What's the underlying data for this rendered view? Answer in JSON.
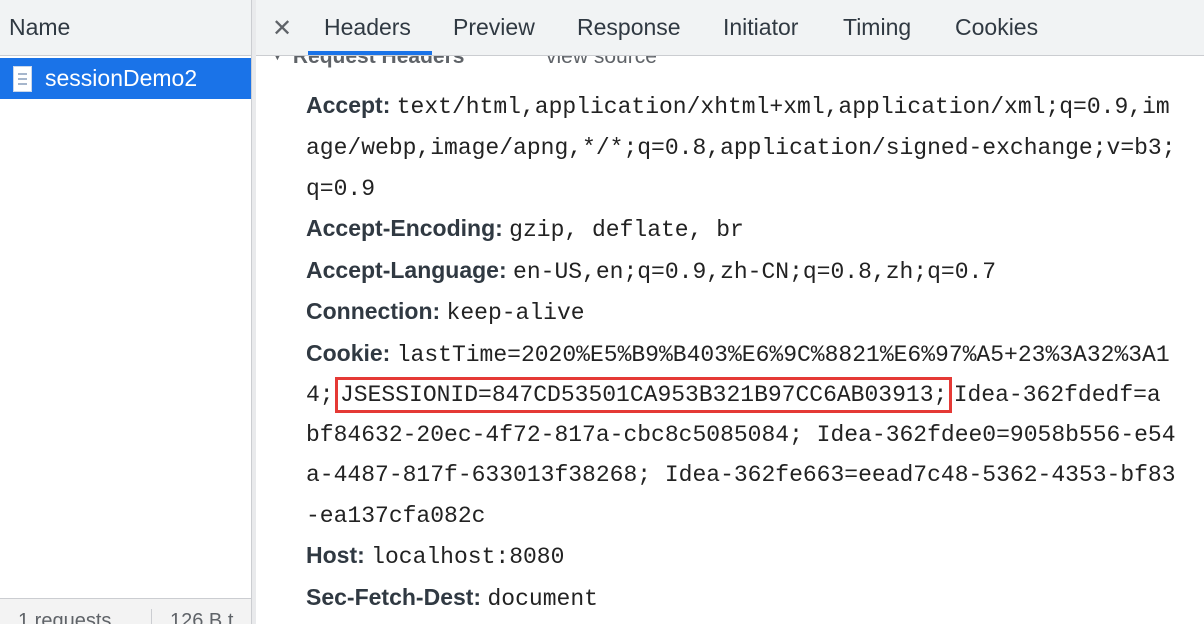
{
  "left_panel": {
    "column_header": "Name",
    "requests": [
      {
        "name": "sessionDemo2",
        "selected": true
      }
    ],
    "status": {
      "requests": "1 requests",
      "transferred": "126 B t"
    }
  },
  "tabs": {
    "close_icon": "close-icon",
    "items": [
      "Headers",
      "Preview",
      "Response",
      "Initiator",
      "Timing",
      "Cookies"
    ],
    "active": "Headers"
  },
  "request_headers": {
    "section_title": "Request Headers",
    "view_source": "view source",
    "accept_key": "Accept:",
    "accept_lines": [
      "text/html,application/xhtml+xml,application/xml;q=0.9,im",
      "age/webp,image/apng,*/*;q=0.8,application/signed-exchange;v=b3;",
      "q=0.9"
    ],
    "accept_encoding_key": "Accept-Encoding:",
    "accept_encoding_val": "gzip, deflate, br",
    "accept_language_key": "Accept-Language:",
    "accept_language_val": "en-US,en;q=0.9,zh-CN;q=0.8,zh;q=0.7",
    "connection_key": "Connection:",
    "connection_val": "keep-alive",
    "cookie_key": "Cookie:",
    "cookie_line1": "lastTime=2020%E5%B9%B403%E6%9C%8821%E6%97%A5+23%3A32%3A1",
    "cookie_line2_prefix": "4;",
    "cookie_session": "JSESSIONID=847CD53501CA953B321B97CC6AB03913;",
    "cookie_line2_suffix": "Idea-362fdedf=a",
    "cookie_lines": [
      "bf84632-20ec-4f72-817a-cbc8c5085084; Idea-362fdee0=9058b556-e54",
      "a-4487-817f-633013f38268; Idea-362fe663=eead7c48-5362-4353-bf83",
      "-ea137cfa082c"
    ],
    "host_key": "Host:",
    "host_val": "localhost:8080",
    "sec_fetch_dest_key": "Sec-Fetch-Dest:",
    "sec_fetch_dest_val": "document"
  },
  "colors": {
    "selected_row": "#1a73e8",
    "highlight_box": "#e53935"
  }
}
